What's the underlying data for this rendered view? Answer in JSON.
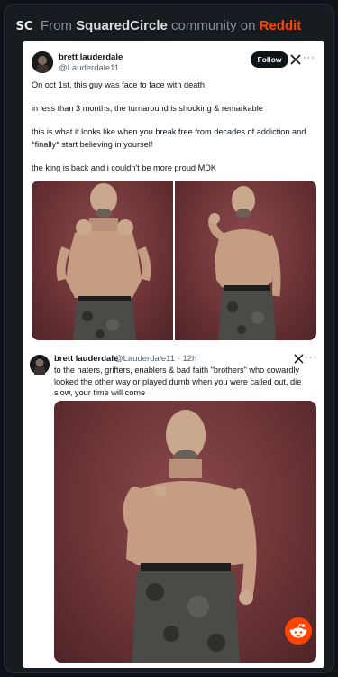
{
  "embed": {
    "prefix": "From ",
    "community": "SquaredCircle",
    "middle": " community on ",
    "platform": "Reddit"
  },
  "tweet": {
    "name": "brett lauderdale",
    "handle": "@Lauderdale11",
    "follow_label": "Follow",
    "paragraphs": [
      "On oct 1st, this guy was face to face with death",
      "in less than 3 months, the turnaround is shocking & remarkable",
      "this is what it looks like when you break free from decades of addiction and *finally* start believing in yourself",
      "the king is back and i couldn't be more proud MDK"
    ]
  },
  "reply": {
    "name": "brett lauderdale",
    "meta": "@Lauderdale11 · 12h",
    "text": "to the haters, grifters, enablers & bad faith \"brothers\" who cowardly looked the other way or played dumb when you were called out, die slow, your time will come"
  },
  "icons": {
    "brand": "squaredcircle-logo-icon",
    "x": "x-logo-icon",
    "more": "more-icon",
    "reddit": "reddit-icon"
  },
  "colors": {
    "reddit": "#ff4500",
    "background": "#171c21",
    "photo_backdrop": "#6e3438"
  }
}
